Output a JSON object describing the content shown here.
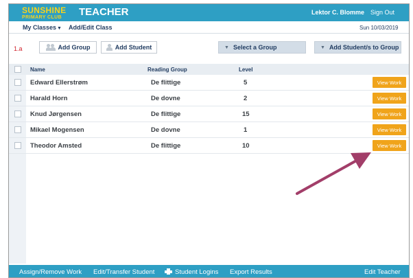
{
  "header": {
    "logo_top": "SUNSHINE",
    "logo_bottom": "PRIMARY CLUB",
    "title": "TEACHER",
    "user_name": "Lektor C. Blomme",
    "sign_out": "Sign Out"
  },
  "nav": {
    "classes": "My Classes",
    "add_edit_class": "Add/Edit Class",
    "date": "Sun 10/03/2019"
  },
  "toolbar": {
    "step_label": "1.a",
    "add_group": "Add Group",
    "add_student": "Add Student",
    "select_group": "Select a Group",
    "add_students_to_group": "Add Student/s to Group"
  },
  "table": {
    "headers": {
      "name": "Name",
      "group": "Reading Group",
      "level": "Level"
    },
    "rows": [
      {
        "name": "Edward Ellerstrøm",
        "group": "De flittige",
        "level": "5",
        "action": "View Work"
      },
      {
        "name": "Harald Horn",
        "group": "De dovne",
        "level": "2",
        "action": "View Work"
      },
      {
        "name": "Knud Jørgensen",
        "group": "De flittige",
        "level": "15",
        "action": "View Work"
      },
      {
        "name": "Mikael Mogensen",
        "group": "De dovne",
        "level": "1",
        "action": "View Work"
      },
      {
        "name": "Theodor Amsted",
        "group": "De flittige",
        "level": "10",
        "action": "View Work"
      }
    ]
  },
  "footer": {
    "assign": "Assign/Remove Work",
    "edit_transfer": "Edit/Transfer Student",
    "logins": "Student Logins",
    "export": "Export Results",
    "edit_teacher": "Edit Teacher"
  },
  "colors": {
    "header_blue": "#2e9fc4",
    "logo_yellow": "#f7d31b",
    "view_work_orange": "#f0a41b",
    "arrow": "#a23e69"
  }
}
